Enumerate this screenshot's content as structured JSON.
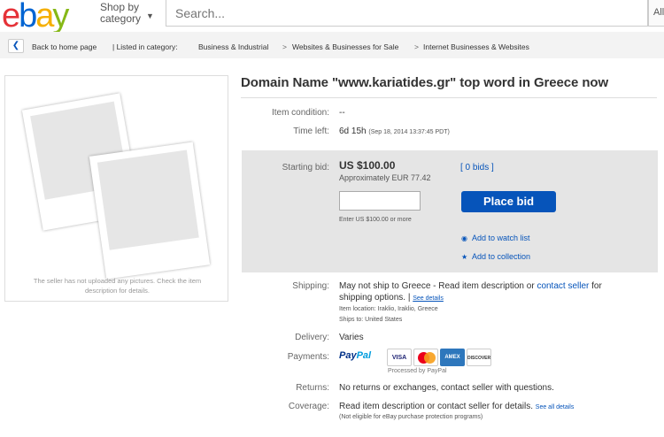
{
  "header": {
    "logo_letters": [
      "e",
      "b",
      "a",
      "y"
    ],
    "shop_by_line1": "Shop by",
    "shop_by_line2": "category",
    "search_placeholder": "Search...",
    "all_categories": "All"
  },
  "breadcrumb": {
    "back": "Back to home page",
    "listed_in": "| Listed in category:",
    "items": [
      "Business & Industrial",
      "Websites & Businesses for Sale",
      "Internet Businesses & Websites"
    ],
    "separator": ">"
  },
  "image_panel": {
    "no_pictures_line1": "The seller has not uploaded any pictures. Check the item",
    "no_pictures_line2": "description for details."
  },
  "listing": {
    "title": "Domain Name \"www.kariatides.gr\" top word in Greece now",
    "condition_label": "Item condition:",
    "condition_value": "--",
    "time_left_label": "Time left:",
    "time_left_value": "6d 15h",
    "time_left_date": "(Sep 18, 2014    13:37:45 PDT)"
  },
  "bid": {
    "starting_bid_label": "Starting bid:",
    "price": "US $100.00",
    "approx": "Approximately EUR 77.42",
    "bids_link": "[ 0 bids ]",
    "input_value": "",
    "hint": "Enter US $100.00 or more",
    "place_bid_label": "Place bid",
    "watch_label": "Add to watch list",
    "collection_label": "Add to collection"
  },
  "shipping": {
    "label": "Shipping:",
    "text1": "May not ship to Greece - Read item description or",
    "contact_link": "contact seller",
    "text2": "for",
    "text3": "shipping options. |",
    "see_details": "See details",
    "location": "Item location:  Iraklio, Iraklio, Greece",
    "ships_to": "Ships to:  United States"
  },
  "delivery": {
    "label": "Delivery:",
    "value": "Varies"
  },
  "payments": {
    "label": "Payments:",
    "paypal_1": "Pay",
    "paypal_2": "Pal",
    "cards": [
      "VISA",
      "MC",
      "AMEX",
      "DISCOVER"
    ],
    "processed": "Processed by PayPal"
  },
  "returns": {
    "label": "Returns:",
    "value": "No returns or exchanges, contact seller with questions."
  },
  "coverage": {
    "label": "Coverage:",
    "value": "Read item description or contact seller for details.",
    "see_all": "See all details",
    "note": "(Not eligible for eBay purchase protection programs)"
  },
  "colors": {
    "ebay_red": "#e53238",
    "ebay_blue": "#0064d2",
    "ebay_yellow": "#f5af02",
    "ebay_green": "#86b817",
    "link_blue": "#0654ba",
    "button_blue": "#0654ba"
  }
}
